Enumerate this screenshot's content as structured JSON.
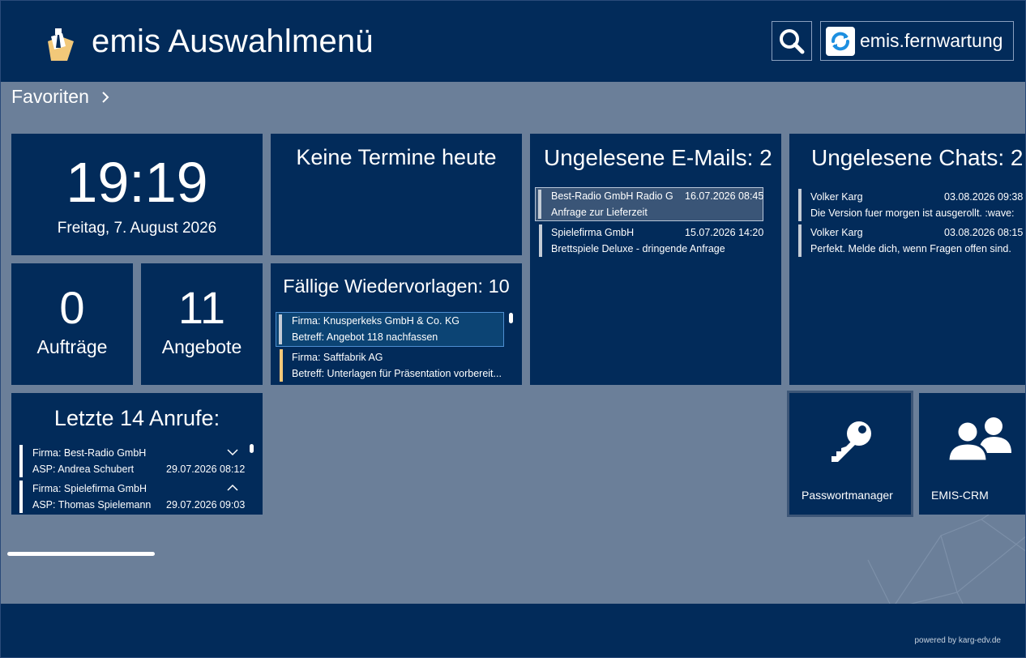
{
  "header": {
    "title": "emis Auswahlmenü",
    "logo_icon": "emis-logo-icon",
    "search_icon": "search-icon",
    "remote_label": "emis.fernwartung",
    "remote_icon": "fernwartung-logo-icon"
  },
  "favorites": {
    "label": "Favoriten",
    "chevron_icon": "chevron-right-icon"
  },
  "clock": {
    "time": "19:19",
    "date": "Freitag, 7. August 2026"
  },
  "termine": {
    "title": "Keine Termine heute"
  },
  "emails": {
    "title": "Ungelesene E-Mails: 2",
    "items": [
      {
        "sender": "Best-Radio GmbH Radio G...",
        "date": "16.07.2026 08:45",
        "subject": "Anfrage zur Lieferzeit"
      },
      {
        "sender": "Spielefirma GmbH",
        "date": "15.07.2026 14:20",
        "subject": "Brettspiele Deluxe - dringende Anfrage"
      }
    ]
  },
  "chats": {
    "title": "Ungelesene Chats: 2",
    "items": [
      {
        "sender": "Volker Karg",
        "date": "03.08.2026 09:38",
        "message": "Die Version fuer morgen ist ausgerollt. :wave:"
      },
      {
        "sender": "Volker Karg",
        "date": "03.08.2026 08:15",
        "message": "Perfekt. Melde dich, wenn Fragen offen sind."
      }
    ]
  },
  "auftraege": {
    "count": "0",
    "label": "Aufträge"
  },
  "angebote": {
    "count": "11",
    "label": "Angebote"
  },
  "wiedervorlagen": {
    "title": "Fällige Wiedervorlagen: 10",
    "items": [
      {
        "firma": "Firma: Knusperkeks GmbH & Co. KG",
        "betreff": "Betreff: Angebot 118 nachfassen",
        "bar_color": "#c4ccd6"
      },
      {
        "firma": "Firma: Saftfabrik AG",
        "betreff": "Betreff: Unterlagen für Präsentation vorbereit...",
        "bar_color": "#f2c879"
      }
    ]
  },
  "anrufe": {
    "title": "Letzte 14 Anrufe:",
    "items": [
      {
        "firma": "Firma: Best-Radio GmbH",
        "asp": "ASP: Andrea Schubert",
        "date": "29.07.2026 08:12",
        "icon": "chevron-down-icon"
      },
      {
        "firma": "Firma: Spielefirma GmbH",
        "asp": "ASP: Thomas Spielemann",
        "date": "29.07.2026 09:03",
        "icon": "chevron-up-icon"
      }
    ]
  },
  "apps": [
    {
      "label": "Passwortmanager",
      "icon": "key-icon"
    },
    {
      "label": "EMIS-CRM",
      "icon": "users-icon"
    }
  ],
  "footer": {
    "powered": "powered by karg-edv.de"
  },
  "colors": {
    "navy": "#022b5a",
    "background": "#6b7f99",
    "accent_yellow": "#f2c879"
  }
}
